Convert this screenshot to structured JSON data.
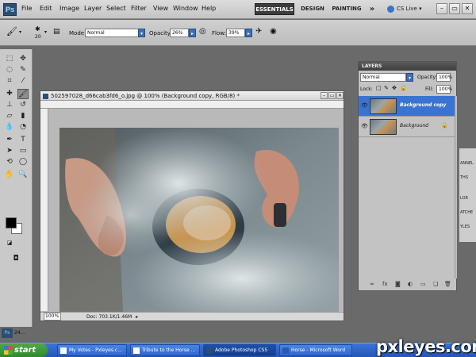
{
  "app": {
    "logo": "Ps"
  },
  "menu": [
    "File",
    "Edit",
    "Image",
    "Layer",
    "Select",
    "Filter",
    "View",
    "Window",
    "Help"
  ],
  "workspace": {
    "essentials": "ESSENTIALS",
    "design": "DESIGN",
    "painting": "PAINTING",
    "more": "»",
    "cs_live": "CS Live"
  },
  "window_controls": {
    "minimize": "–",
    "restore": "▭",
    "close": "✕"
  },
  "options": {
    "brush_size": "20",
    "mode_label": "Mode:",
    "mode_value": "Normal",
    "opacity_label": "Opacity:",
    "opacity_value": "26%",
    "flow_label": "Flow:",
    "flow_value": "39%"
  },
  "document": {
    "title": "502597028_d66cab3fd6_o.jpg @ 100% (Background copy, RGB/8) *",
    "zoom": "100%",
    "doc_info": "Doc: 703.1K/1.46M"
  },
  "layers_panel": {
    "tab": "LAYERS",
    "blend_mode": "Normal",
    "opacity_label": "Opacity:",
    "opacity_value": "100%",
    "lock_label": "Lock:",
    "fill_label": "Fill:",
    "fill_value": "100%",
    "layers": [
      {
        "name": "Background copy",
        "selected": true
      },
      {
        "name": "Background",
        "selected": false
      }
    ]
  },
  "side_panel": [
    "ANNEL",
    "THS",
    "LOR",
    "ATCHE",
    "YLES"
  ],
  "taskbar": {
    "start": "start",
    "tasks": [
      {
        "label": "My Votes - Pxleyes.c..."
      },
      {
        "label": "Tribute to the Horse ..."
      },
      {
        "label": "Adobe Photoshop CS5"
      },
      {
        "label": "Horse - Microsoft Word"
      }
    ],
    "minimized_doc": "24..."
  },
  "watermark": "pxleyes.com",
  "colors": {
    "selected_layer": "#3a74d2",
    "taskbar": "#2456b8",
    "workspace_active": "#3c3c3c"
  }
}
